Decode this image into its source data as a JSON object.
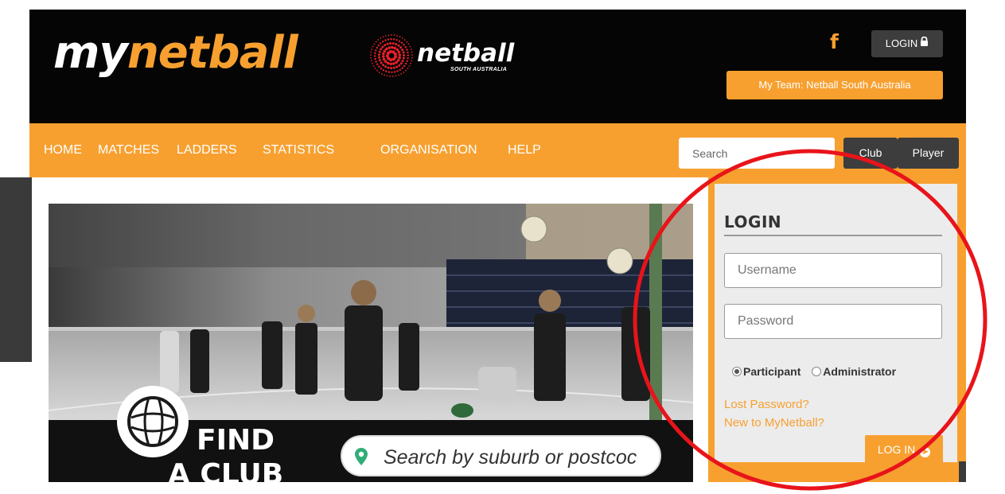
{
  "header": {
    "logo_prefix": "my",
    "logo_suffix": "netball",
    "partner_name": "netball",
    "partner_subtitle": "SOUTH AUSTRALIA",
    "facebook_glyph": "f",
    "login_label": "LOGIN",
    "team_label": "My Team: Netball South Australia"
  },
  "nav": {
    "items": [
      "HOME",
      "MATCHES",
      "LADDERS",
      "STATISTICS",
      "ORGANISATION",
      "HELP"
    ],
    "search_placeholder": "Search",
    "club_button": "Club",
    "player_button": "Player"
  },
  "hero": {
    "find_line1": "FIND",
    "find_line2": "A CLUB",
    "search_text": "Search by suburb or postcoc"
  },
  "login": {
    "title": "LOGIN",
    "username_placeholder": "Username",
    "password_placeholder": "Password",
    "role_options": [
      "Participant",
      "Administrator"
    ],
    "selected_role": "Participant",
    "lost_password": "Lost Password?",
    "new_user": "New to MyNetball?",
    "submit_label": "LOG IN"
  },
  "colors": {
    "brand_orange": "#f7a030",
    "header_black": "#050505",
    "button_dark": "#3d3d3d",
    "annotation_red": "#e8141a"
  },
  "icons": [
    "facebook-icon",
    "lock-icon",
    "pin-icon",
    "arrow-circle-right-icon",
    "netball-icon"
  ]
}
